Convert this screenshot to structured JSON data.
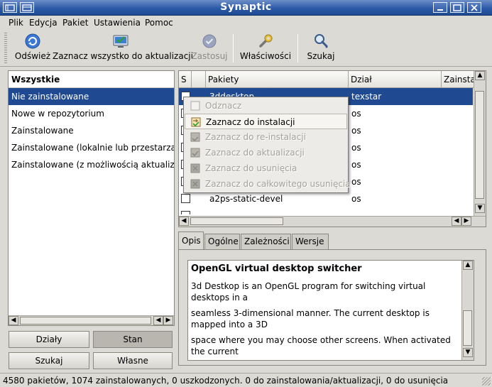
{
  "window": {
    "title": "Synaptic"
  },
  "menu": [
    "Plik",
    "Edycja",
    "Pakiet",
    "Ustawienia",
    "Pomoc"
  ],
  "toolbar": {
    "refresh": "Odśwież",
    "mark_upgrades": "Zaznacz wszystko do aktualizacji",
    "apply": "Zastosuj",
    "properties": "Właściwości",
    "search": "Szukaj"
  },
  "filters": {
    "header": "Wszystkie",
    "items": [
      "Nie zainstalowane",
      "Nowe w repozytorium",
      "Zainstalowane",
      "Zainstalowane (lokalnie lub przestarzałe)",
      "Zainstalowane (z możliwością aktualizacji)"
    ]
  },
  "view_buttons": {
    "sections": "Działy",
    "status": "Stan",
    "search": "Szukaj",
    "custom": "Własne"
  },
  "package_list": {
    "columns": {
      "s": "S",
      "packages": "Pakiety",
      "section": "Dział",
      "installed": "Zainsta"
    },
    "rows": [
      {
        "name": "3ddesktop",
        "section": "texstar"
      },
      {
        "name": "",
        "section": "os"
      },
      {
        "name": "",
        "section": "os"
      },
      {
        "name": "",
        "section": "os"
      },
      {
        "name": "",
        "section": "os"
      },
      {
        "name": "",
        "section": "os"
      },
      {
        "name": "a2ps-static-devel",
        "section": "os"
      }
    ]
  },
  "context_menu": [
    "Odznacz",
    "Zaznacz do instalacji",
    "Zaznacz do re-instalacji",
    "Zaznacz do aktualizacji",
    "Zaznacz do usunięcia",
    "Zaznacz do całkowitego usunięcia"
  ],
  "tabs": [
    "Opis",
    "Ogólne",
    "Zależności",
    "Wersje"
  ],
  "description": {
    "title": "OpenGL virtual desktop switcher",
    "lines": [
      "3d Destkop is an OpenGL program for switching virtual desktops in a",
      " seamless 3-dimensional manner. The current desktop is mapped into a 3D",
      " space where you may choose other screens. When activated the current"
    ]
  },
  "status": "4580 pakietów, 1074 zainstalowanych, 0 uszkodzonych. 0 do zainstalowania/aktualizacji, 0 do usunięcia"
}
